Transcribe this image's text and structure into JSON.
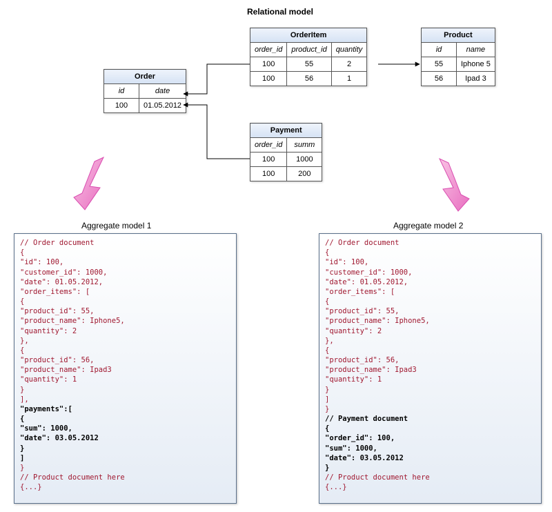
{
  "titles": {
    "top": "Relational model",
    "agg1": "Aggregate model 1",
    "agg2": "Aggregate model 2"
  },
  "order": {
    "name": "Order",
    "cols": [
      "id",
      "date"
    ],
    "rows": [
      [
        "100",
        "01.05.2012"
      ]
    ]
  },
  "orderitem": {
    "name": "OrderItem",
    "cols": [
      "order_id",
      "product_id",
      "quantity"
    ],
    "rows": [
      [
        "100",
        "55",
        "2"
      ],
      [
        "100",
        "56",
        "1"
      ]
    ]
  },
  "product": {
    "name": "Product",
    "cols": [
      "id",
      "name"
    ],
    "rows": [
      [
        "55",
        "Iphone 5"
      ],
      [
        "56",
        "Ipad 3"
      ]
    ]
  },
  "payment": {
    "name": "Payment",
    "cols": [
      "order_id",
      "summ"
    ],
    "rows": [
      [
        "100",
        "1000"
      ],
      [
        "100",
        "200"
      ]
    ]
  },
  "agg1": {
    "lines": [
      {
        "t": "// Order document"
      },
      {
        "t": "{"
      },
      {
        "t": "\"id\": 100,"
      },
      {
        "t": "\"customer_id\": 1000,"
      },
      {
        "t": "\"date\": 01.05.2012,"
      },
      {
        "t": "\"order_items\": ["
      },
      {
        "t": "              {"
      },
      {
        "t": "              \"product_id\": 55,"
      },
      {
        "t": "              \"product_name\": Iphone5,"
      },
      {
        "t": "              \"quantity\": 2"
      },
      {
        "t": "              },"
      },
      {
        "t": "              {"
      },
      {
        "t": "              \"product_id\": 56,"
      },
      {
        "t": "              \"product_name\": Ipad3"
      },
      {
        "t": "              \"quantity\": 1"
      },
      {
        "t": "              }"
      },
      {
        "t": "],"
      },
      {
        "t": "\"payments\":[",
        "cls": "black"
      },
      {
        "t": "              {",
        "cls": "black"
      },
      {
        "t": "              \"sum\": 1000,",
        "cls": "black"
      },
      {
        "t": "              \"date\": 03.05.2012",
        "cls": "black"
      },
      {
        "t": "              }",
        "cls": "black"
      },
      {
        "t": "]",
        "cls": "black"
      },
      {
        "t": "}"
      },
      {
        "t": "// Product document here"
      },
      {
        "t": "{...}"
      }
    ]
  },
  "agg2": {
    "lines": [
      {
        "t": "// Order document"
      },
      {
        "t": "{"
      },
      {
        "t": "\"id\": 100,"
      },
      {
        "t": "\"customer_id\": 1000,"
      },
      {
        "t": "\"date\": 01.05.2012,"
      },
      {
        "t": "\"order_items\": ["
      },
      {
        "t": "              {"
      },
      {
        "t": "              \"product_id\": 55,"
      },
      {
        "t": "              \"product_name\": Iphone5,"
      },
      {
        "t": "              \"quantity\": 2"
      },
      {
        "t": "              },"
      },
      {
        "t": "              {"
      },
      {
        "t": "              \"product_id\": 56,"
      },
      {
        "t": "              \"product_name\": Ipad3"
      },
      {
        "t": "              \"quantity\": 1"
      },
      {
        "t": "              }"
      },
      {
        "t": "]"
      },
      {
        "t": "}"
      },
      {
        "t": "// Payment document",
        "cls": "black"
      },
      {
        "t": "{",
        "cls": "black"
      },
      {
        "t": "\"order_id\": 100,",
        "cls": "black"
      },
      {
        "t": "\"sum\": 1000,",
        "cls": "black"
      },
      {
        "t": "\"date\": 03.05.2012",
        "cls": "black"
      },
      {
        "t": "}",
        "cls": "black"
      },
      {
        "t": "// Product document here"
      },
      {
        "t": "{...}"
      }
    ]
  }
}
